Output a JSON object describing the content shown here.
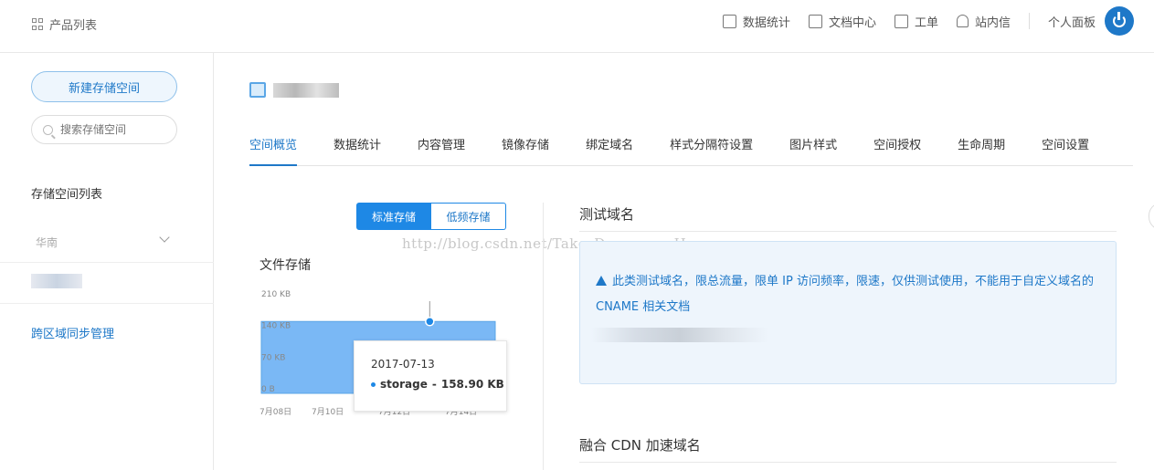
{
  "topbar": {
    "product_list": "产品列表",
    "nav": [
      {
        "label": "数据统计",
        "icon": "chart-icon"
      },
      {
        "label": "文档中心",
        "icon": "document-icon"
      },
      {
        "label": "工单",
        "icon": "clipboard-icon"
      },
      {
        "label": "站内信",
        "icon": "bell-icon"
      }
    ],
    "personal_panel": "个人面板"
  },
  "sidebar": {
    "new_bucket": "新建存储空间",
    "search_placeholder": "搜索存储空间",
    "list_title": "存储空间列表",
    "region": "华南",
    "cross_region_sync": "跨区域同步管理"
  },
  "tabs": [
    "空间概览",
    "数据统计",
    "内容管理",
    "镜像存储",
    "绑定域名",
    "样式分隔符设置",
    "图片样式",
    "空间授权",
    "生命周期",
    "空间设置"
  ],
  "storage_toggle": {
    "standard": "标准存储",
    "low_freq": "低频存储"
  },
  "watermark": "http://blog.csdn.net/Take_Dream_as_Horse",
  "file_storage_title": "文件存储",
  "chart_data": {
    "type": "area",
    "title": "文件存储",
    "x": [
      "7月08日",
      "7月10日",
      "7月12日",
      "7月14日"
    ],
    "y_ticks": [
      "210 KB",
      "140 KB",
      "70 KB",
      "0 B"
    ],
    "ylim": [
      0,
      210
    ],
    "series": [
      {
        "name": "storage",
        "values": [
          158.9,
          158.9,
          158.9,
          158.9,
          158.9,
          158.9,
          158.9,
          158.9
        ]
      }
    ],
    "color": "#7ab8f5",
    "tooltip": {
      "date": "2017-07-13",
      "series": "storage",
      "value": "158.90 KB"
    }
  },
  "test_domain": {
    "title": "测试域名",
    "warning": "此类测试域名，限总流量，限单 IP 访问频率，限速，仅供测试使用，不能用于自定义域名的 CNAME",
    "doc_link": "相关文档"
  },
  "cdn_title": "融合 CDN 加速域名"
}
